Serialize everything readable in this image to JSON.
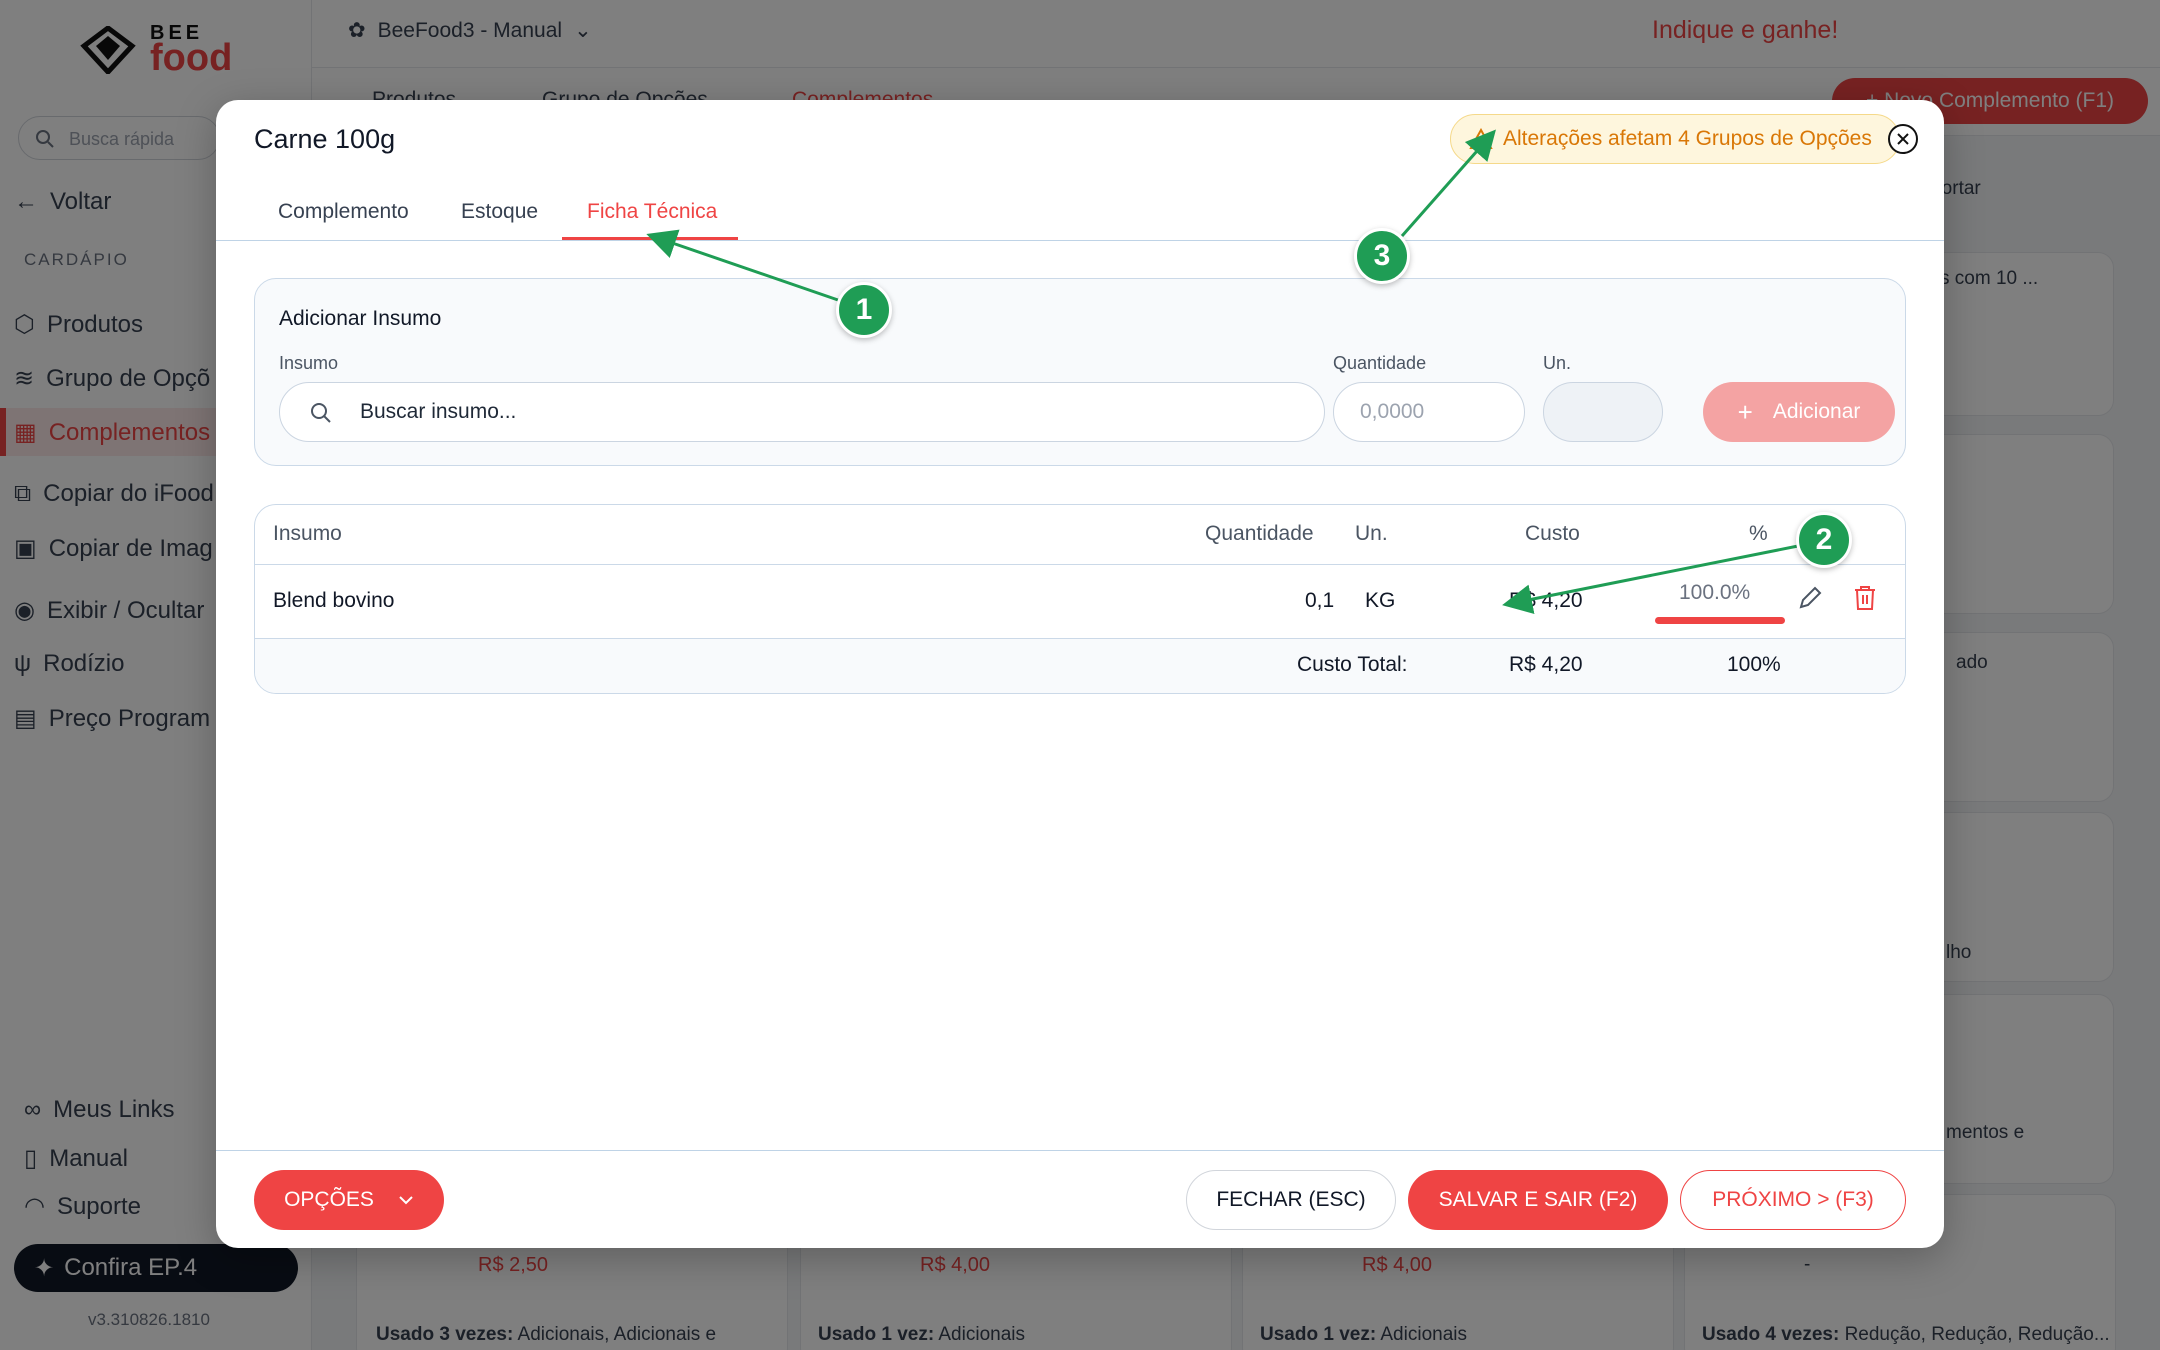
{
  "app": {
    "brand_top": "BEE",
    "brand_bottom": "food",
    "store_name": "BeeFood3 - Manual",
    "indique": "Indique e ganhe!",
    "search_placeholder": "Busca rápida",
    "back": "Voltar",
    "section": "CARDÁPIO",
    "nav": [
      "Produtos",
      "Grupo de Opçõ",
      "Complementos",
      "Copiar do iFood",
      "Copiar de Imag",
      "Exibir / Ocultar",
      "Rodízio",
      "Preço Program"
    ],
    "bottom_links": [
      "Meus Links",
      "Manual",
      "Suporte"
    ],
    "confira": "Confira EP.4",
    "version": "v3.310826.1810",
    "subnav": [
      "Produtos",
      "Grupo de Opções",
      "Complementos"
    ],
    "new_button": "+ Novo Complemento (F1)",
    "importar": "Importar",
    "bg_cards": {
      "texts": [
        "s com 10 ...",
        "ado",
        "lho",
        "mentos e"
      ],
      "prices": [
        "R$ 2,50",
        "R$ 4,00",
        "R$ 4,00",
        "-"
      ],
      "usage": [
        {
          "bold": "Usado 3 vezes:",
          "rest": " Adicionais, Adicionais e"
        },
        {
          "bold": "Usado 1 vez:",
          "rest": " Adicionais"
        },
        {
          "bold": "Usado 1 vez:",
          "rest": " Adicionais"
        },
        {
          "bold": "Usado 4 vezes:",
          "rest": " Redução, Redução, Redução..."
        }
      ]
    }
  },
  "modal": {
    "title": "Carne 100g",
    "alert": "Alterações afetam 4 Grupos de Opções",
    "tabs": [
      "Complemento",
      "Estoque",
      "Ficha Técnica"
    ],
    "active_tab": "Ficha Técnica",
    "add_section": {
      "title": "Adicionar Insumo",
      "insumo_label": "Insumo",
      "insumo_placeholder": "Buscar insumo...",
      "quantidade_label": "Quantidade",
      "quantidade_placeholder": "0,0000",
      "unidade_label": "Un.",
      "add_button": "Adicionar"
    },
    "table": {
      "headers": [
        "Insumo",
        "Quantidade",
        "Un.",
        "Custo",
        "%"
      ],
      "rows": [
        {
          "insumo": "Blend bovino",
          "quantidade": "0,1",
          "unidade": "KG",
          "custo": "R$ 4,20",
          "percent": "100.0%",
          "percent_value": 1.0
        }
      ],
      "total_label": "Custo Total:",
      "total_custo": "R$ 4,20",
      "total_percent": "100%"
    },
    "footer": {
      "opcoes": "OPÇÕES",
      "fechar": "FECHAR (ESC)",
      "salvar": "SALVAR E SAIR (F2)",
      "proximo": "PRÓXIMO > (F3)"
    }
  },
  "annotations": [
    "1",
    "2",
    "3"
  ],
  "colors": {
    "accent": "#ef4444",
    "annotation": "#1f9d55",
    "warning": "#d97706"
  }
}
